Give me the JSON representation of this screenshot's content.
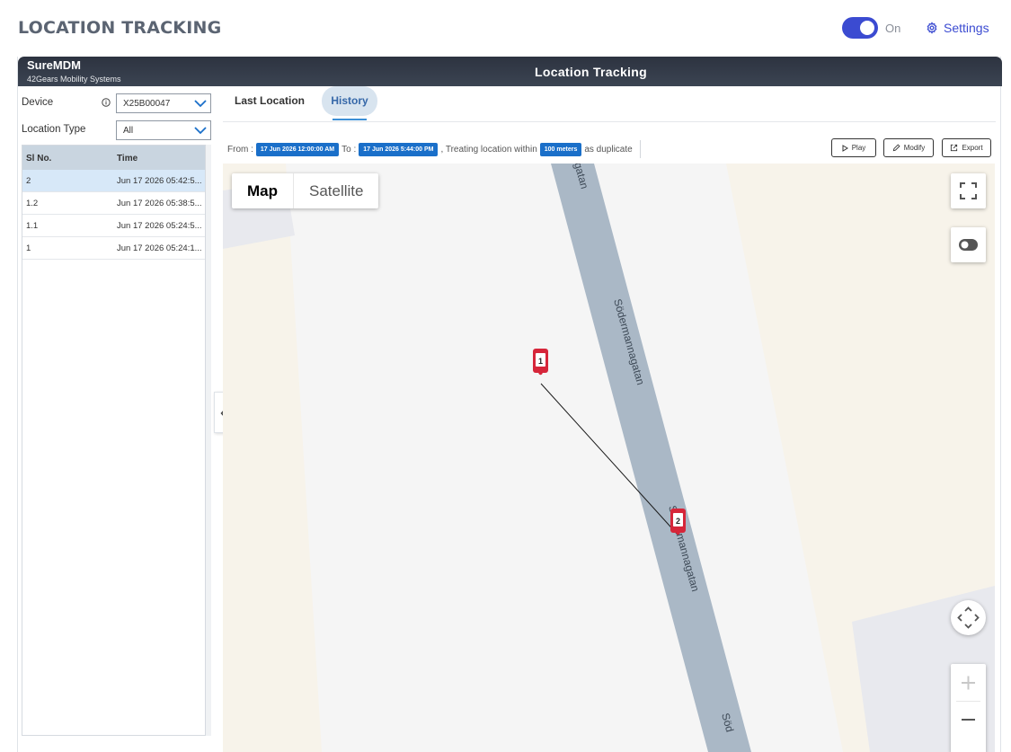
{
  "page": {
    "title": "LOCATION TRACKING",
    "toggle_label": "On",
    "settings_label": "Settings"
  },
  "header": {
    "brand": "SureMDM",
    "brand_sub": "42Gears Mobility Systems",
    "title": "Location Tracking"
  },
  "left": {
    "device_label": "Device",
    "device_value": "X25B00047",
    "location_type_label": "Location Type",
    "location_type_value": "All",
    "table": {
      "headers": [
        "Sl No.",
        "Time"
      ],
      "rows": [
        {
          "sl": "2",
          "time": "Jun 17 2026 05:42:5..."
        },
        {
          "sl": "1.2",
          "time": "Jun 17 2026 05:38:5..."
        },
        {
          "sl": "1.1",
          "time": "Jun 17 2026 05:24:5..."
        },
        {
          "sl": "1",
          "time": "Jun 17 2026 05:24:1..."
        }
      ]
    }
  },
  "tabs": {
    "last_location": "Last Location",
    "history": "History"
  },
  "filter": {
    "from_label": "From :",
    "from_value": "17 Jun 2026 12:00:00 AM",
    "to_label": "To :",
    "to_value": "17 Jun 2026 5:44:00 PM",
    "treating_text": ", Treating location within",
    "distance_value": "100 meters",
    "duplicate_text": "as duplicate"
  },
  "actions": {
    "play": "Play",
    "modify": "Modify",
    "export": "Export"
  },
  "map": {
    "type_map": "Map",
    "type_satellite": "Satellite",
    "street_name": "Södermannagatan",
    "street_name_top": "gatan",
    "street_name_bottom": "Söd",
    "marker_1": "1",
    "marker_2": "2"
  },
  "colors": {
    "accent": "#3b4bd1",
    "chip": "#1a6fc9",
    "marker": "#d6263a",
    "road": "#aab8c6"
  }
}
